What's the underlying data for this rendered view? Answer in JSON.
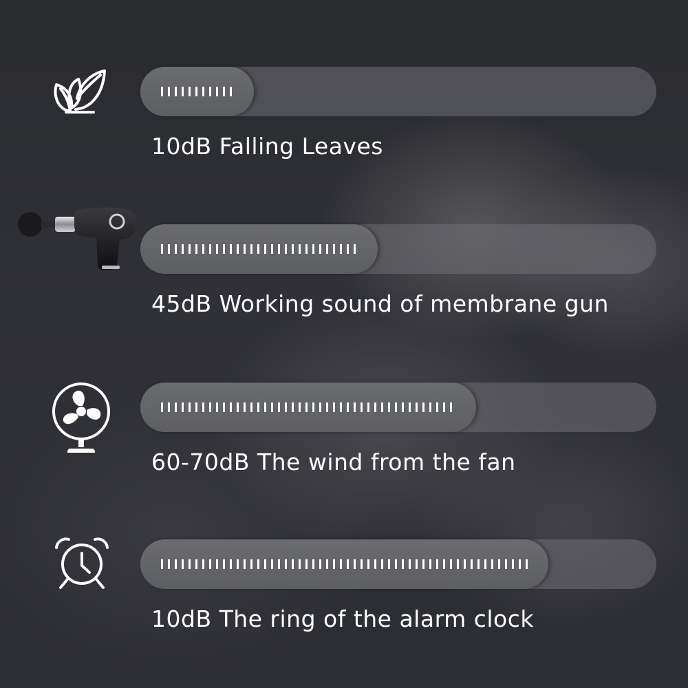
{
  "background": {
    "subject": "sleeping-baby-photo",
    "tone": "#2b2c30"
  },
  "rows": [
    {
      "icon": "leaves-icon",
      "label": "10dB Falling Leaves",
      "level": 0.22
    },
    {
      "icon": "massage-gun-icon",
      "label": "45dB Working sound of membrane gun",
      "level": 0.46
    },
    {
      "icon": "fan-icon",
      "label": "60-70dB The wind from the fan",
      "level": 0.65
    },
    {
      "icon": "alarm-clock-icon",
      "label": "10dB The ring of the alarm clock",
      "level": 0.79
    }
  ],
  "colors": {
    "text": "#ffffff",
    "track": "#707074",
    "fill": "#666669",
    "ticks": "#ffffff"
  }
}
